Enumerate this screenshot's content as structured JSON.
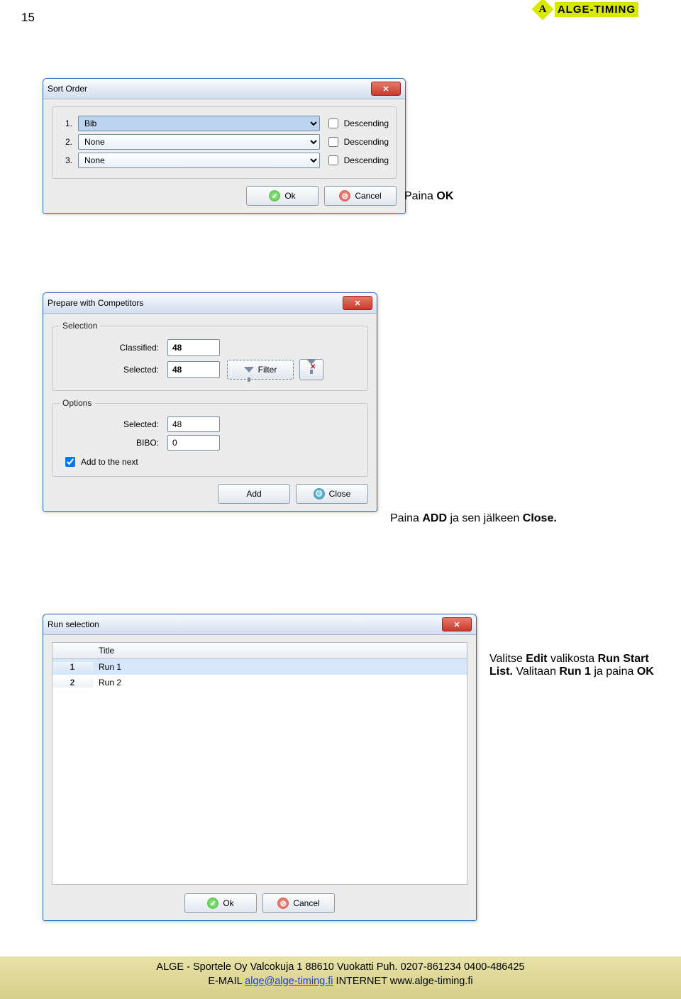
{
  "page_number": "15",
  "logo_letter": "A",
  "brand": "ALGE-TIMING",
  "d1": {
    "title": "Sort Order",
    "rows": [
      {
        "num": "1.",
        "value": "Bib",
        "desc": "Descending"
      },
      {
        "num": "2.",
        "value": "None",
        "desc": "Descending"
      },
      {
        "num": "3.",
        "value": "None",
        "desc": "Descending"
      }
    ],
    "ok": "Ok",
    "cancel": "Cancel"
  },
  "caption1_a": "Paina ",
  "caption1_b": "OK",
  "d2": {
    "title": "Prepare with Competitors",
    "leg_sel": "Selection",
    "lbl_classified": "Classified:",
    "val_classified": "48",
    "lbl_selected": "Selected:",
    "val_selected": "48",
    "filter": "Filter",
    "leg_opt": "Options",
    "lbl_selected2": "Selected:",
    "val_selected2": "48",
    "lbl_bibo": "BIBO:",
    "val_bibo": "0",
    "chk_add": "Add to the next",
    "btn_add": "Add",
    "btn_close": "Close"
  },
  "caption2_a": "Paina ",
  "caption2_b": "ADD",
  "caption2_c": " ja sen jälkeen ",
  "caption2_d": "Close.",
  "d3": {
    "title": "Run selection",
    "header_title": "Title",
    "rows": [
      {
        "num": "1",
        "title": "Run 1"
      },
      {
        "num": "2",
        "title": "Run 2"
      }
    ],
    "ok": "Ok",
    "cancel": "Cancel"
  },
  "caption3_a": "Valitse ",
  "caption3_b": "Edit",
  "caption3_c": " valikosta ",
  "caption3_d": "Run Start List.",
  "caption3_e": " Valitaan ",
  "caption3_f": "Run 1",
  "caption3_g": " ja paina ",
  "caption3_h": "OK",
  "footer": {
    "l1a": "ALGE - Sportele Oy Valcokuja 1 88610 Vuokatti  Puh. 0207-861234  0400-486425",
    "l2a": "E-MAIL  ",
    "l2b": "alge@alge-timing.fi",
    "l2c": "   INTERNET   www.alge-timing.fi"
  }
}
